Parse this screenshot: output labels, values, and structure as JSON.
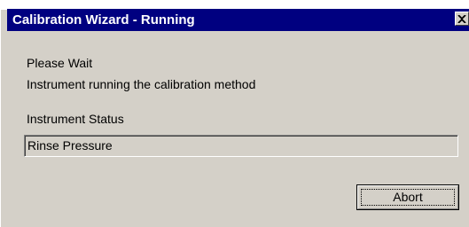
{
  "window": {
    "title": "Calibration Wizard - Running",
    "close_icon": "close-icon"
  },
  "content": {
    "message_line1": "Please Wait",
    "message_line2": "Instrument running the calibration method",
    "status_label": "Instrument Status",
    "status_value": "Rinse Pressure"
  },
  "buttons": {
    "abort_label": "Abort"
  },
  "colors": {
    "titlebar": "#000080",
    "face": "#d4d0c8"
  }
}
